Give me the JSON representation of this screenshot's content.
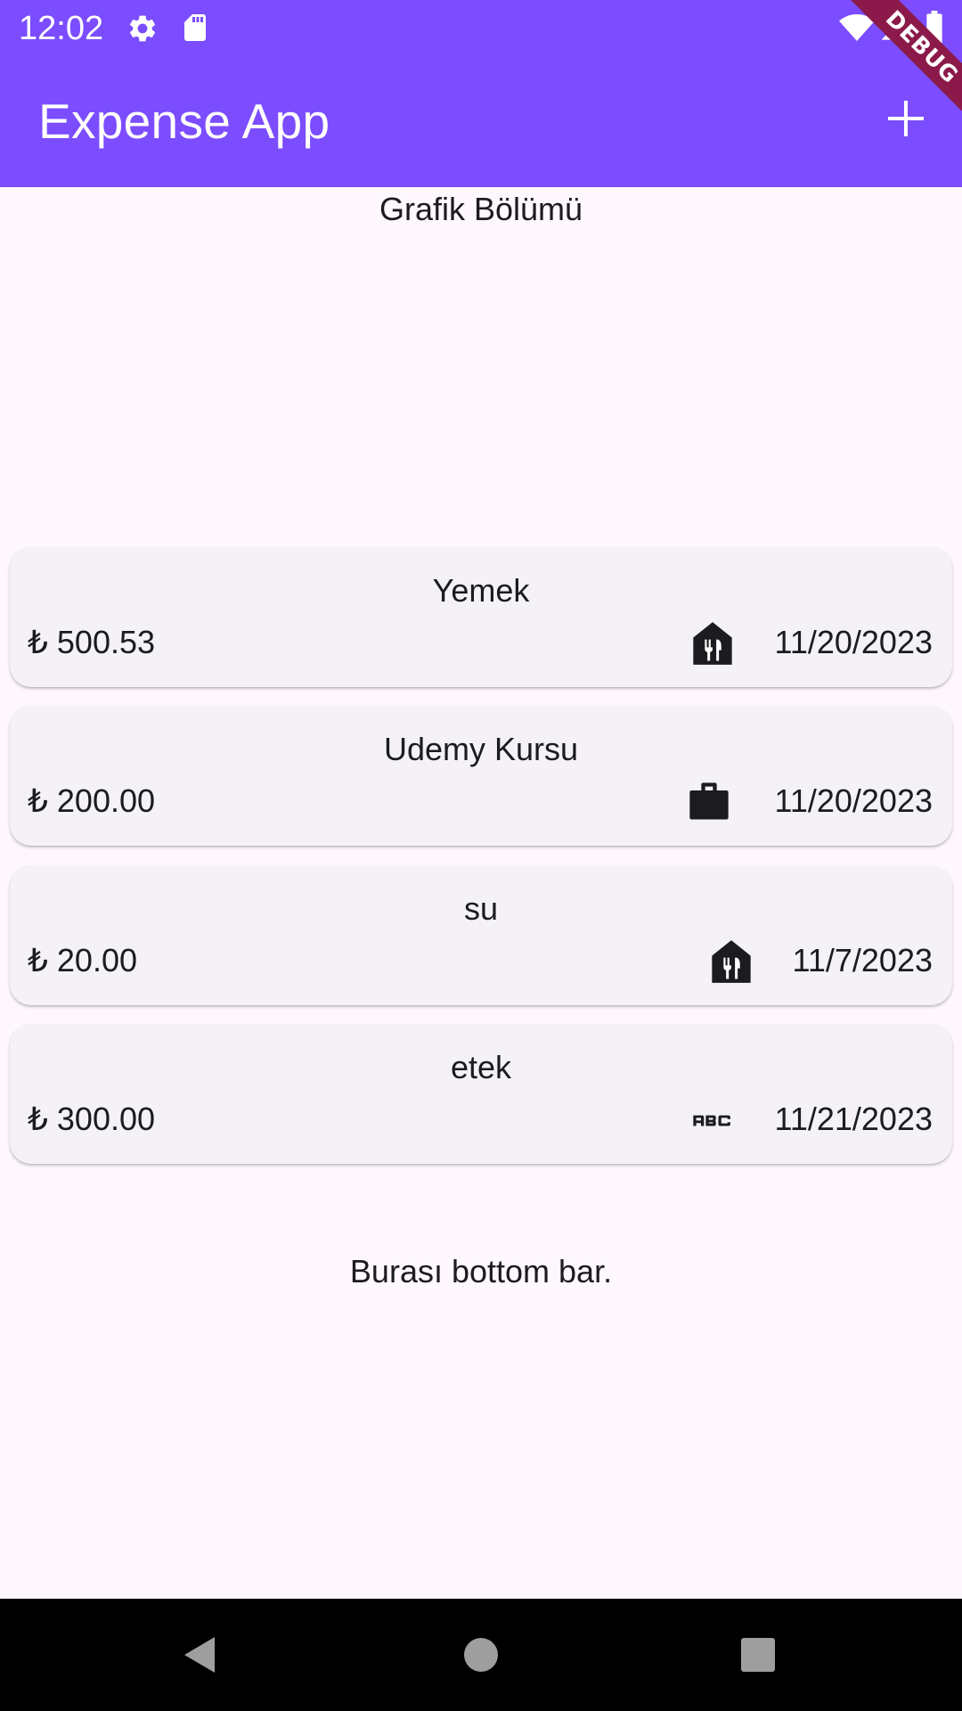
{
  "status_bar": {
    "time": "12:02",
    "icons": [
      "gear-icon",
      "sd-card-icon",
      "wifi-icon",
      "signal-icon",
      "battery-icon"
    ]
  },
  "app_bar": {
    "title": "Expense App",
    "add_icon": "plus-icon",
    "debug_banner": "DEBUG",
    "color": "#7C4DFF"
  },
  "chart_section": {
    "title": "Grafik Bölümü"
  },
  "expenses": [
    {
      "title": "Yemek",
      "amount": "₺ 500.53",
      "category_icon": "food-icon",
      "date": "11/20/2023"
    },
    {
      "title": "Udemy Kursu",
      "amount": "₺ 200.00",
      "category_icon": "briefcase-icon",
      "date": "11/20/2023"
    },
    {
      "title": "su",
      "amount": "₺ 20.00",
      "category_icon": "food-icon",
      "date": "11/7/2023"
    },
    {
      "title": "etek",
      "amount": "₺ 300.00",
      "category_icon": "abc-icon",
      "date": "11/21/2023"
    }
  ],
  "bottom_bar": {
    "text": "Burası bottom bar."
  },
  "navigation": {
    "back_icon": "back-icon",
    "home_icon": "home-icon",
    "recents_icon": "recents-icon"
  },
  "colors": {
    "primary": "#7C4DFF",
    "background": "#FFF7FE",
    "card": "#F4F1F7",
    "text": "#1C1B1F",
    "debug_ribbon": "#8B1A4A"
  }
}
